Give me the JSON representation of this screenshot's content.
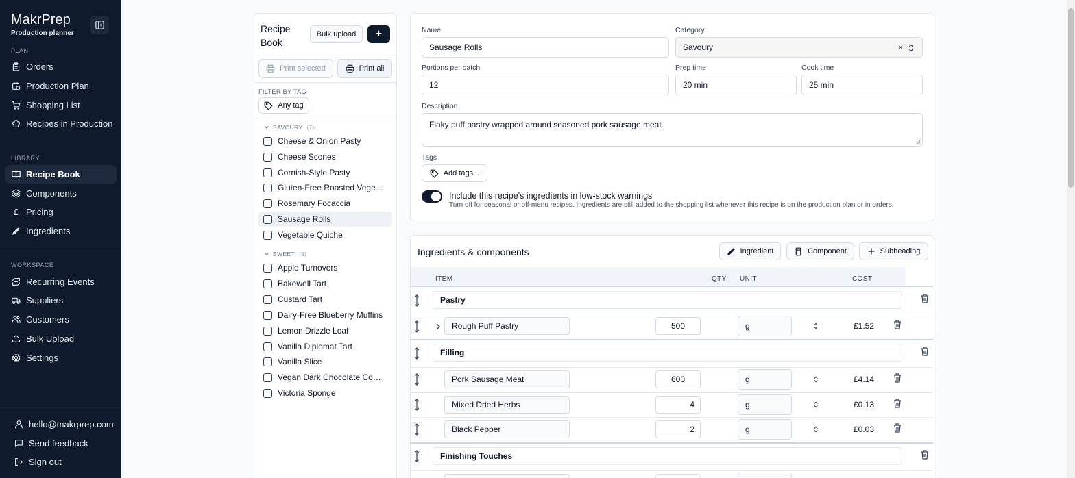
{
  "app": {
    "name": "MakrPrep",
    "subtitle": "Production planner"
  },
  "sidebar": {
    "sections": [
      {
        "label": "PLAN",
        "items": [
          {
            "label": "Orders",
            "icon": "clipboard-icon"
          },
          {
            "label": "Production Plan",
            "icon": "calendar-clock-icon"
          },
          {
            "label": "Shopping List",
            "icon": "cart-icon"
          },
          {
            "label": "Recipes in Production",
            "icon": "chef-hat-icon"
          }
        ]
      },
      {
        "label": "LIBRARY",
        "items": [
          {
            "label": "Recipe Book",
            "icon": "book-icon",
            "active": true
          },
          {
            "label": "Components",
            "icon": "layers-icon"
          },
          {
            "label": "Pricing",
            "icon": "pound-icon"
          },
          {
            "label": "Ingredients",
            "icon": "wheat-icon"
          }
        ]
      },
      {
        "label": "WORKSPACE",
        "items": [
          {
            "label": "Recurring Events",
            "icon": "recurring-icon"
          },
          {
            "label": "Suppliers",
            "icon": "truck-icon"
          },
          {
            "label": "Customers",
            "icon": "users-icon"
          },
          {
            "label": "Bulk Upload",
            "icon": "upload-icon"
          },
          {
            "label": "Settings",
            "icon": "gear-icon"
          }
        ]
      }
    ],
    "footer": {
      "email": "hello@makrprep.com",
      "feedback": "Send feedback",
      "signout": "Sign out"
    }
  },
  "recipe_book": {
    "title": "Recipe Book",
    "bulk_upload": "Bulk upload",
    "add": "+",
    "print_selected": "Print selected",
    "print_all": "Print all",
    "filter_label": "FILTER BY TAG",
    "any_tag": "Any tag",
    "groups": [
      {
        "label": "SAVOURY",
        "count": "(7)",
        "recipes": [
          "Cheese & Onion Pasty",
          "Cheese Scones",
          "Cornish-Style Pasty",
          "Gluten-Free Roasted Vegetable Tart",
          "Rosemary Focaccia",
          "Sausage Rolls",
          "Vegetable Quiche"
        ]
      },
      {
        "label": "SWEET",
        "count": "(9)",
        "recipes": [
          "Apple Turnovers",
          "Bakewell Tart",
          "Custard Tart",
          "Dairy-Free Blueberry Muffins",
          "Lemon Drizzle Loaf",
          "Vanilla Diplomat Tart",
          "Vanilla Slice",
          "Vegan Dark Chocolate Cookies",
          "Victoria Sponge"
        ]
      }
    ],
    "selected": "Sausage Rolls"
  },
  "details": {
    "name_label": "Name",
    "name": "Sausage Rolls",
    "category_label": "Category",
    "category": "Savoury",
    "portions_label": "Portions per batch",
    "portions": "12",
    "prep_label": "Prep time",
    "prep": "20 min",
    "cook_label": "Cook time",
    "cook": "25 min",
    "description_label": "Description",
    "description": "Flaky puff pastry wrapped around seasoned pork sausage meat.",
    "tags_label": "Tags",
    "add_tags": "Add tags...",
    "lowstock_on": true,
    "lowstock_label": "Include this recipe's ingredients in low-stock warnings",
    "lowstock_help": "Turn off for seasonal or off-menu recipes. Ingredients are still added to the shopping list whenever this recipe is on the production plan or in orders."
  },
  "ingredients": {
    "title": "Ingredients & components",
    "add_ingredient": "Ingredient",
    "add_component": "Component",
    "add_subheading": "Subheading",
    "columns": {
      "item": "ITEM",
      "qty": "QTY",
      "unit": "UNIT",
      "cost": "COST"
    },
    "sections": [
      {
        "heading": "Pastry",
        "rows": [
          {
            "item": "Rough Puff Pastry",
            "qty": "500",
            "unit": "g",
            "cost": "£1.52",
            "expandable": true
          }
        ]
      },
      {
        "heading": "Filling",
        "rows": [
          {
            "item": "Pork Sausage Meat",
            "qty": "600",
            "unit": "g",
            "cost": "£4.14"
          },
          {
            "item": "Mixed Dried Herbs",
            "qty": "4",
            "unit": "g",
            "cost": "£0.13"
          },
          {
            "item": "Black Pepper",
            "qty": "2",
            "unit": "g",
            "cost": "£0.03"
          }
        ]
      },
      {
        "heading": "Finishing Touches",
        "rows": []
      }
    ]
  },
  "colors": {
    "sidebar_bg": "#0f1b2d",
    "accent": "#0f1b2d",
    "page_bg": "#f8fafc"
  }
}
